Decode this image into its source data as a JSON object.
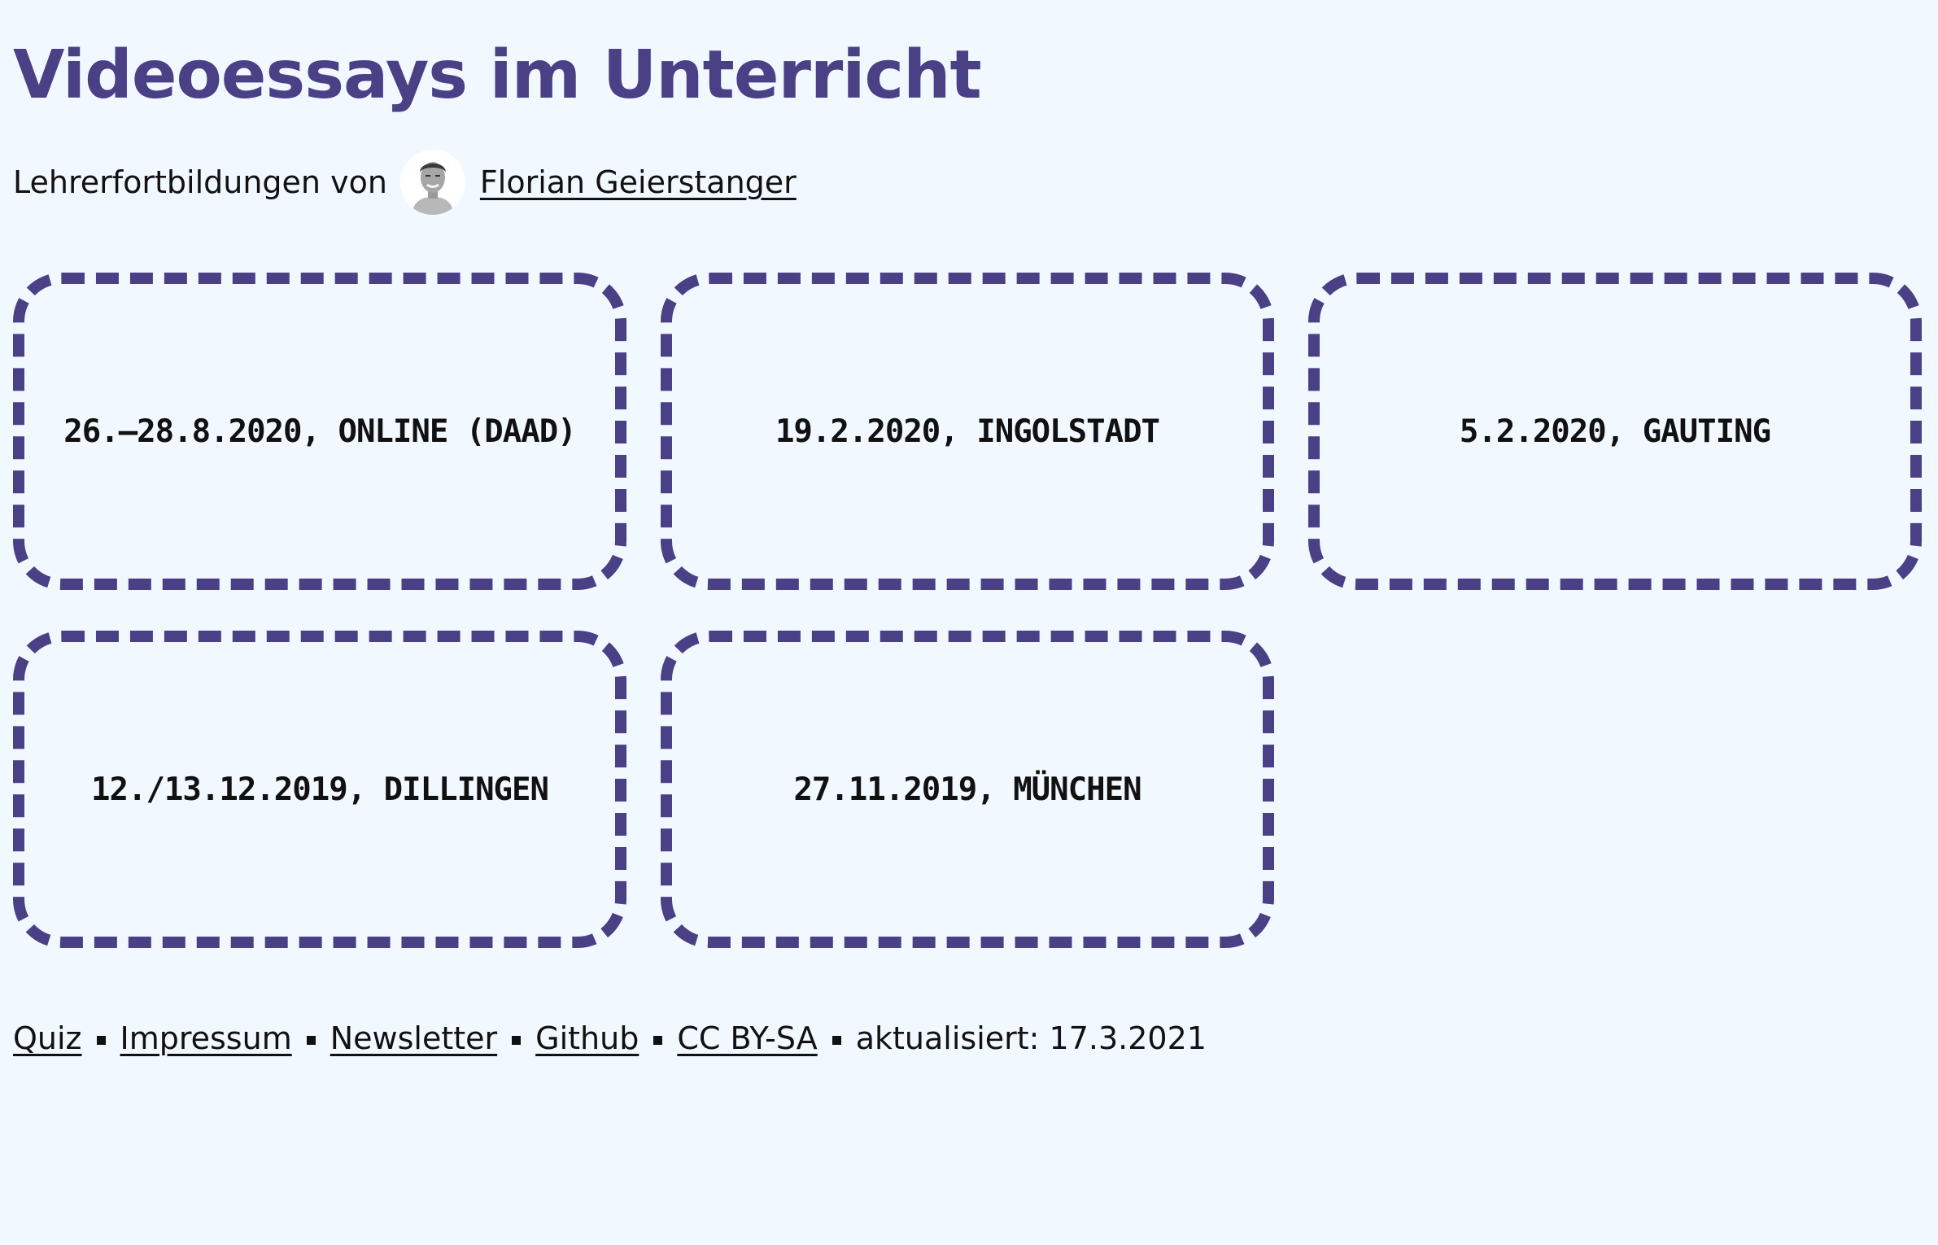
{
  "theme": {
    "accent": "#4a4086",
    "background": "#f2f8ff",
    "text": "#111111"
  },
  "header": {
    "title": "Videoessays im Unterricht",
    "byline_prefix": "Lehrerfortbildungen von",
    "author_name": "Florian Geierstanger",
    "avatar_icon": "author-avatar-photo"
  },
  "workshops": [
    {
      "label": "26.–28.8.2020, Online (DAAD)"
    },
    {
      "label": "19.2.2020, Ingolstadt"
    },
    {
      "label": "5.2.2020, Gauting"
    },
    {
      "label": "12./13.12.2019, Dillingen"
    },
    {
      "label": "27.11.2019, München"
    }
  ],
  "footer": {
    "links": {
      "quiz": "Quiz",
      "impressum": "Impressum",
      "newsletter": "Newsletter",
      "github": "Github",
      "license": "CC BY-SA"
    },
    "updated": "aktualisiert: 17.3.2021"
  }
}
